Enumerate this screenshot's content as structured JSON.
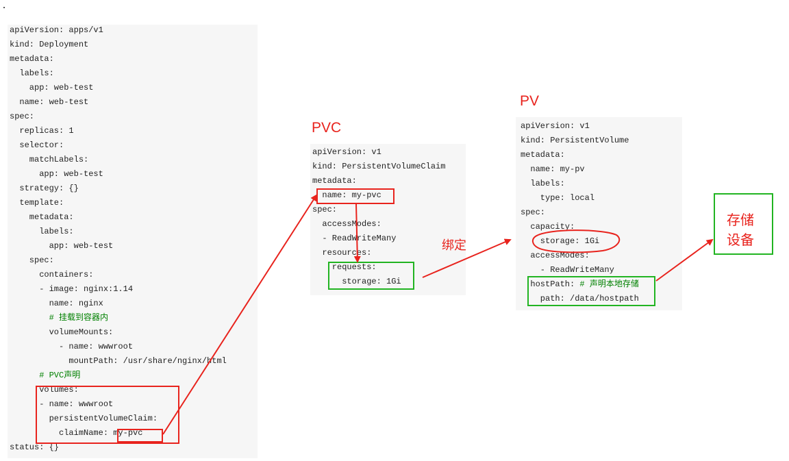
{
  "deployment": {
    "lines": [
      {
        "text": "apiVersion: apps/v1"
      },
      {
        "text": "kind: Deployment"
      },
      {
        "text": "metadata:"
      },
      {
        "text": "  labels:"
      },
      {
        "text": "    app: web-test"
      },
      {
        "text": "  name: web-test"
      },
      {
        "text": "spec:"
      },
      {
        "text": "  replicas: 1"
      },
      {
        "text": "  selector:"
      },
      {
        "text": "    matchLabels:"
      },
      {
        "text": "      app: web-test"
      },
      {
        "text": "  strategy: {}"
      },
      {
        "text": "  template:"
      },
      {
        "text": "    metadata:"
      },
      {
        "text": "      labels:"
      },
      {
        "text": "        app: web-test"
      },
      {
        "text": "    spec:"
      },
      {
        "text": "      containers:"
      },
      {
        "text": "      - image: nginx:1.14"
      },
      {
        "text": "        name: nginx"
      },
      {
        "text": "        # 挂载到容器内",
        "comment": true
      },
      {
        "text": "        volumeMounts:"
      },
      {
        "text": "          - name: wwwroot"
      },
      {
        "text": "            mountPath: /usr/share/nginx/html"
      },
      {
        "text": "      # PVC声明",
        "comment": true
      },
      {
        "text": "      volumes:"
      },
      {
        "text": "      - name: wwwroot"
      },
      {
        "text": "        persistentVolumeClaim:"
      },
      {
        "text": "          claimName: my-pvc"
      },
      {
        "text": "status: {}"
      }
    ]
  },
  "pvc": {
    "title": "PVC",
    "lines": [
      {
        "text": "apiVersion: v1"
      },
      {
        "text": "kind: PersistentVolumeClaim"
      },
      {
        "text": "metadata:"
      },
      {
        "text": "  name: my-pvc"
      },
      {
        "text": "spec:"
      },
      {
        "text": "  accessModes:"
      },
      {
        "text": "  - ReadWriteMany"
      },
      {
        "text": "  resources:"
      },
      {
        "text": "    requests:"
      },
      {
        "text": "      storage: 1Gi"
      }
    ]
  },
  "pv": {
    "title": "PV",
    "lines": [
      {
        "text": "apiVersion: v1"
      },
      {
        "text": "kind: PersistentVolume"
      },
      {
        "text": "metadata:"
      },
      {
        "text": "  name: my-pv"
      },
      {
        "text": "  labels:"
      },
      {
        "text": "    type: local"
      },
      {
        "text": "spec:"
      },
      {
        "text": "  capacity:"
      },
      {
        "text": "    storage: 1Gi"
      },
      {
        "text": "  accessModes:"
      },
      {
        "text": "    - ReadWriteMany"
      },
      {
        "text": "  hostPath: # 声明本地存储",
        "comment_from": "# 声明本地存储"
      },
      {
        "text": "    path: /data/hostpath"
      }
    ]
  },
  "labels": {
    "bind": "绑定",
    "storage_line1": "存储",
    "storage_line2": "设备"
  },
  "colors": {
    "annotation_red": "#e8231d",
    "highlight_green": "#21b421",
    "comment_green": "#008000",
    "panel_bg": "#f6f6f6"
  }
}
